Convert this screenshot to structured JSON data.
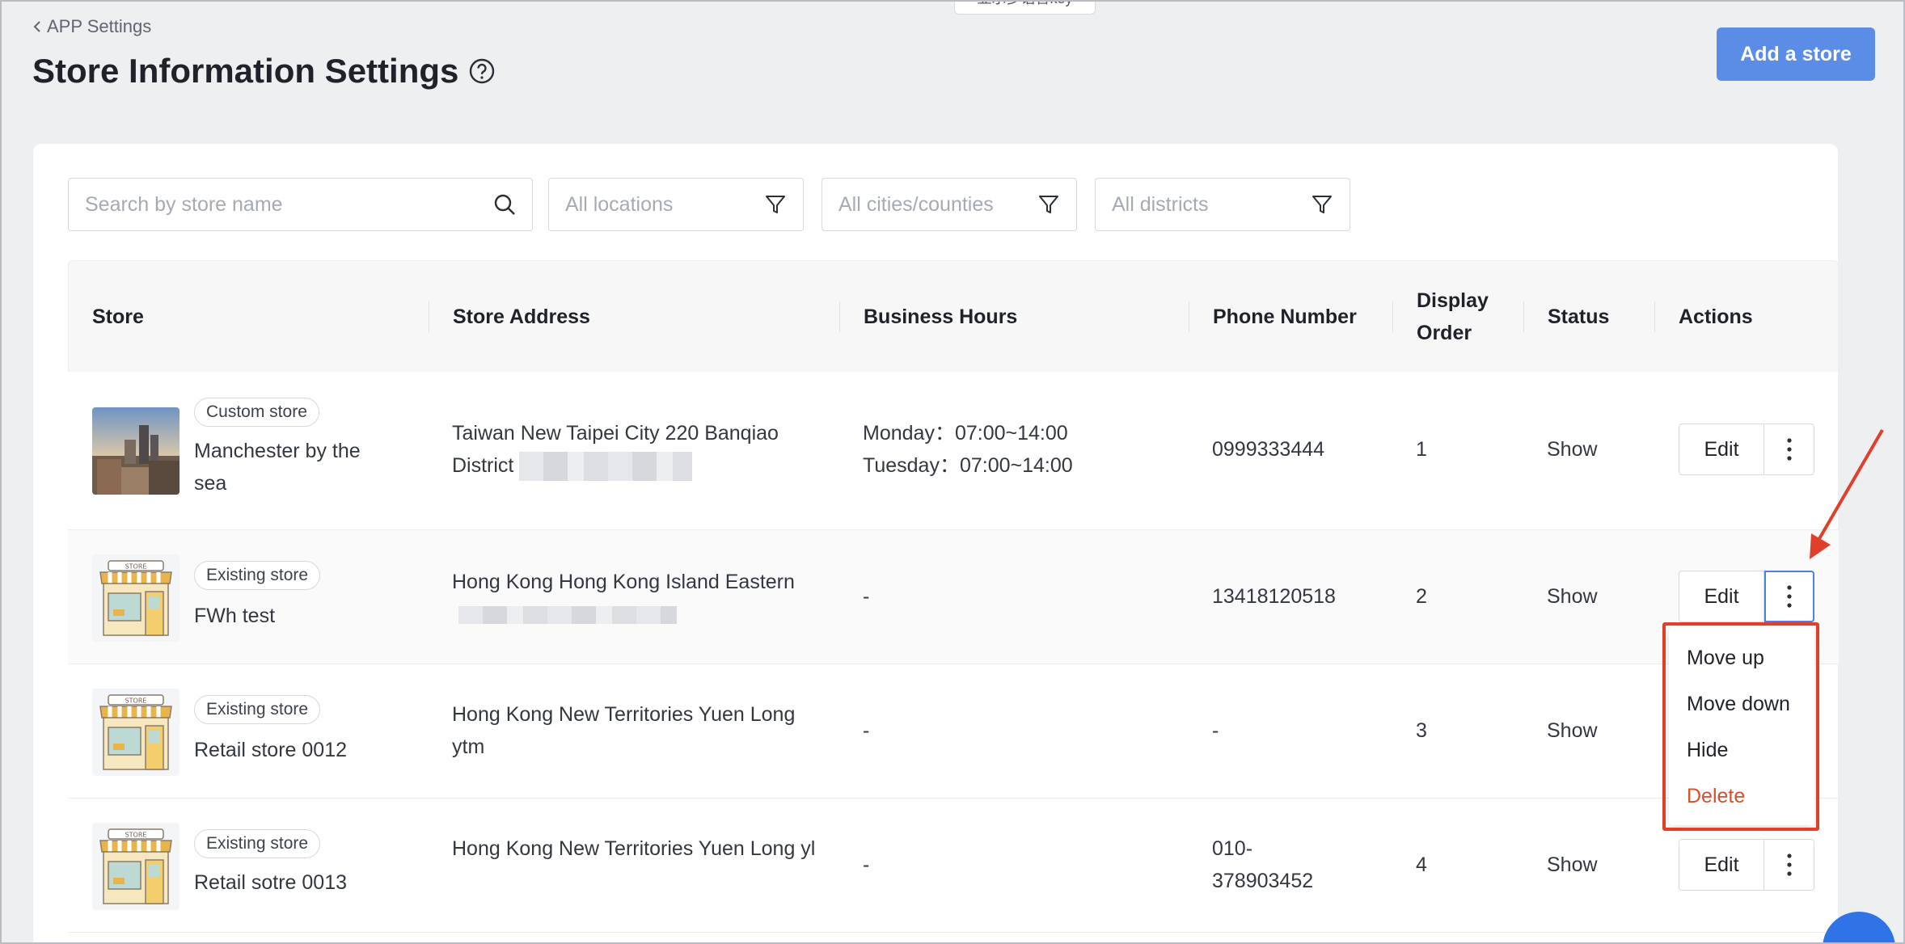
{
  "top_tab": {
    "label": "显示多语言key"
  },
  "breadcrumb": {
    "back_label": "APP Settings"
  },
  "page": {
    "title": "Store Information Settings"
  },
  "header_actions": {
    "add_store_label": "Add a store"
  },
  "filters": {
    "search_placeholder": "Search by store name",
    "locations_placeholder": "All locations",
    "cities_placeholder": "All cities/counties",
    "districts_placeholder": "All districts"
  },
  "table": {
    "columns": [
      "Store",
      "Store Address",
      "Business Hours",
      "Phone Number",
      "Display\nOrder",
      "Status",
      "Actions"
    ],
    "rows": [
      {
        "badge": "Custom store",
        "name": "Manchester by the sea",
        "address": "Taiwan New Taipei City 220 Banqiao District",
        "hours": [
          "Monday：07:00~14:00",
          "Tuesday：07:00~14:00"
        ],
        "phone": "0999333444",
        "order": "1",
        "status": "Show"
      },
      {
        "badge": "Existing store",
        "name": "FWh test",
        "address": "Hong Kong Hong Kong Island Eastern",
        "hours": [
          "-"
        ],
        "phone": "13418120518",
        "order": "2",
        "status": "Show"
      },
      {
        "badge": "Existing store",
        "name": "Retail store 0012",
        "address": "Hong Kong New Territories Yuen Long ytm",
        "hours": [
          "-"
        ],
        "phone": "-",
        "order": "3",
        "status": "Show"
      },
      {
        "badge": "Existing store",
        "name": "Retail sotre 0013",
        "address": "Hong Kong New Territories Yuen Long yl",
        "hours": [
          "-"
        ],
        "phone": "010-378903452",
        "order": "4",
        "status": "Show"
      }
    ],
    "edit_label": "Edit"
  },
  "row_menu": {
    "items": [
      "Move up",
      "Move down",
      "Hide"
    ],
    "danger_item": "Delete"
  },
  "colors": {
    "primary": "#5b8de6",
    "danger": "#d4512e",
    "highlight": "#e0402a"
  }
}
